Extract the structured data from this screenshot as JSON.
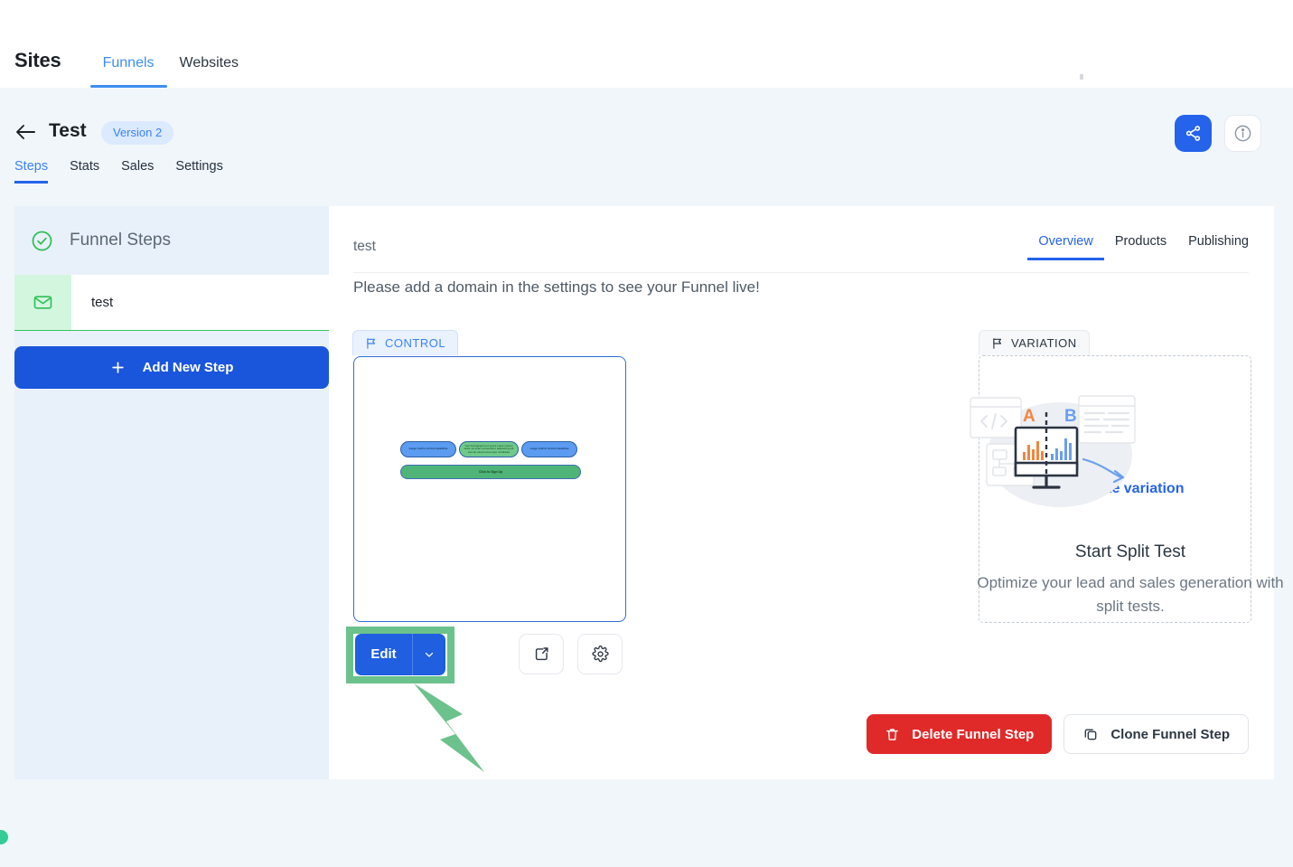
{
  "topbar": {
    "brand": "Sites",
    "tabs": [
      {
        "label": "Funnels",
        "active": true
      },
      {
        "label": "Websites",
        "active": false
      }
    ]
  },
  "header": {
    "back_icon": "arrow-left-icon",
    "title": "Test",
    "version_badge": "Version 2",
    "subtabs": [
      {
        "label": "Steps",
        "active": true
      },
      {
        "label": "Stats",
        "active": false
      },
      {
        "label": "Sales",
        "active": false
      },
      {
        "label": "Settings",
        "active": false
      }
    ],
    "share_icon": "share-icon",
    "info_icon": "info-icon"
  },
  "sidebar": {
    "header_label": "Funnel Steps",
    "header_icon": "check-circle-icon",
    "steps": [
      {
        "label": "test",
        "icon": "envelope-icon"
      }
    ],
    "add_step_label": "Add New Step",
    "add_step_icon": "plus-icon"
  },
  "panel": {
    "title": "test",
    "tabs": [
      {
        "label": "Overview",
        "active": true
      },
      {
        "label": "Products",
        "active": false
      },
      {
        "label": "Publishing",
        "active": false
      }
    ],
    "domain_note": "Please add a domain in the settings to see your Funnel live!"
  },
  "control": {
    "badge_label": "CONTROL",
    "badge_icon": "flag-icon",
    "thumbnail": {
      "pill_left": "Large Call to Action Headline",
      "pill_center": "Your Paragraph text goes Lorem ipsum dolor sit amet consectetur adipiscing elit sed do eiusmod tempor incididunt",
      "pill_right": "Large Call to Action Headline",
      "cta": "Click to Sign Up"
    },
    "edit_label": "Edit",
    "edit_caret_icon": "chevron-down-icon",
    "open_icon": "external-link-icon",
    "settings_icon": "gear-icon",
    "highlight_color": "#6cc28c"
  },
  "promo": {
    "illustration": "ab-split-test-illustration",
    "letter_a": "A",
    "letter_b": "B",
    "title": "Start Split Test",
    "subtitle": "Optimize your lead and sales generation with split tests."
  },
  "variation": {
    "badge_label": "VARIATION",
    "badge_icon": "flag-icon",
    "create_label": "Create variation",
    "create_icon": "plus-icon"
  },
  "actions": {
    "delete_label": "Delete Funnel Step",
    "delete_icon": "trash-icon",
    "clone_label": "Clone Funnel Step",
    "clone_icon": "copy-icon"
  },
  "colors": {
    "accent_blue": "#2563eb",
    "link_blue": "#3b82f6",
    "danger_red": "#e02a2a",
    "success_green": "#34c45f",
    "highlight_green": "#6cc28c",
    "page_bg": "#f1f6fa"
  }
}
